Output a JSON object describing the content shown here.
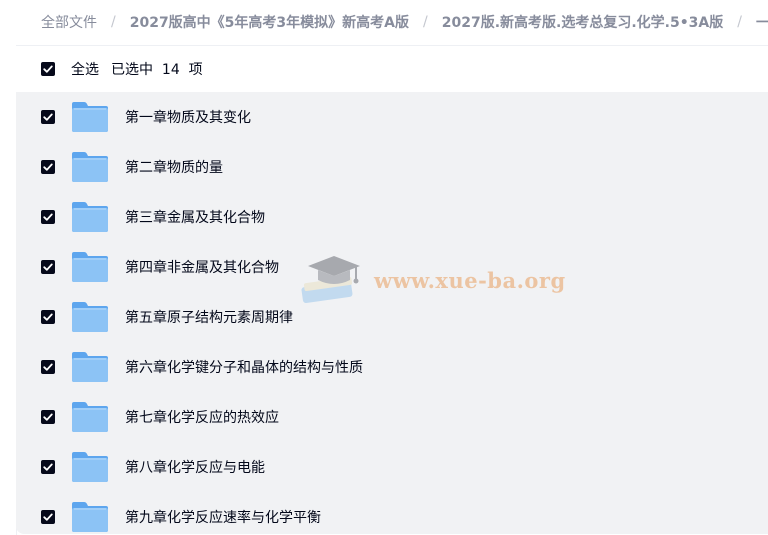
{
  "breadcrumb": {
    "items": [
      "全部文件",
      "2027版高中《5年高考3年模拟》新高考A版",
      "2027版.新高考版.选考总复习.化学.5•3A版",
      "一"
    ],
    "separator": "/"
  },
  "selection": {
    "select_all_label": "全选",
    "selected_text": "已选中",
    "selected_count": "14",
    "unit": "项",
    "all_checked": true
  },
  "files": [
    {
      "name": "第一章物质及其变化",
      "checked": true
    },
    {
      "name": "第二章物质的量",
      "checked": true
    },
    {
      "name": "第三章金属及其化合物",
      "checked": true
    },
    {
      "name": "第四章非金属及其化合物",
      "checked": true
    },
    {
      "name": "第五章原子结构元素周期律",
      "checked": true
    },
    {
      "name": "第六章化学键分子和晶体的结构与性质",
      "checked": true
    },
    {
      "name": "第七章化学反应的热效应",
      "checked": true
    },
    {
      "name": "第八章化学反应与电能",
      "checked": true
    },
    {
      "name": "第九章化学反应速率与化学平衡",
      "checked": true
    }
  ],
  "watermark": {
    "text": "www.xue-ba.org",
    "icon": "graduation-cap-icon"
  },
  "colors": {
    "accent": "#06091a",
    "folder": "#74b6f2",
    "list_bg": "#f1f2f4",
    "watermark": "#e8a060"
  }
}
